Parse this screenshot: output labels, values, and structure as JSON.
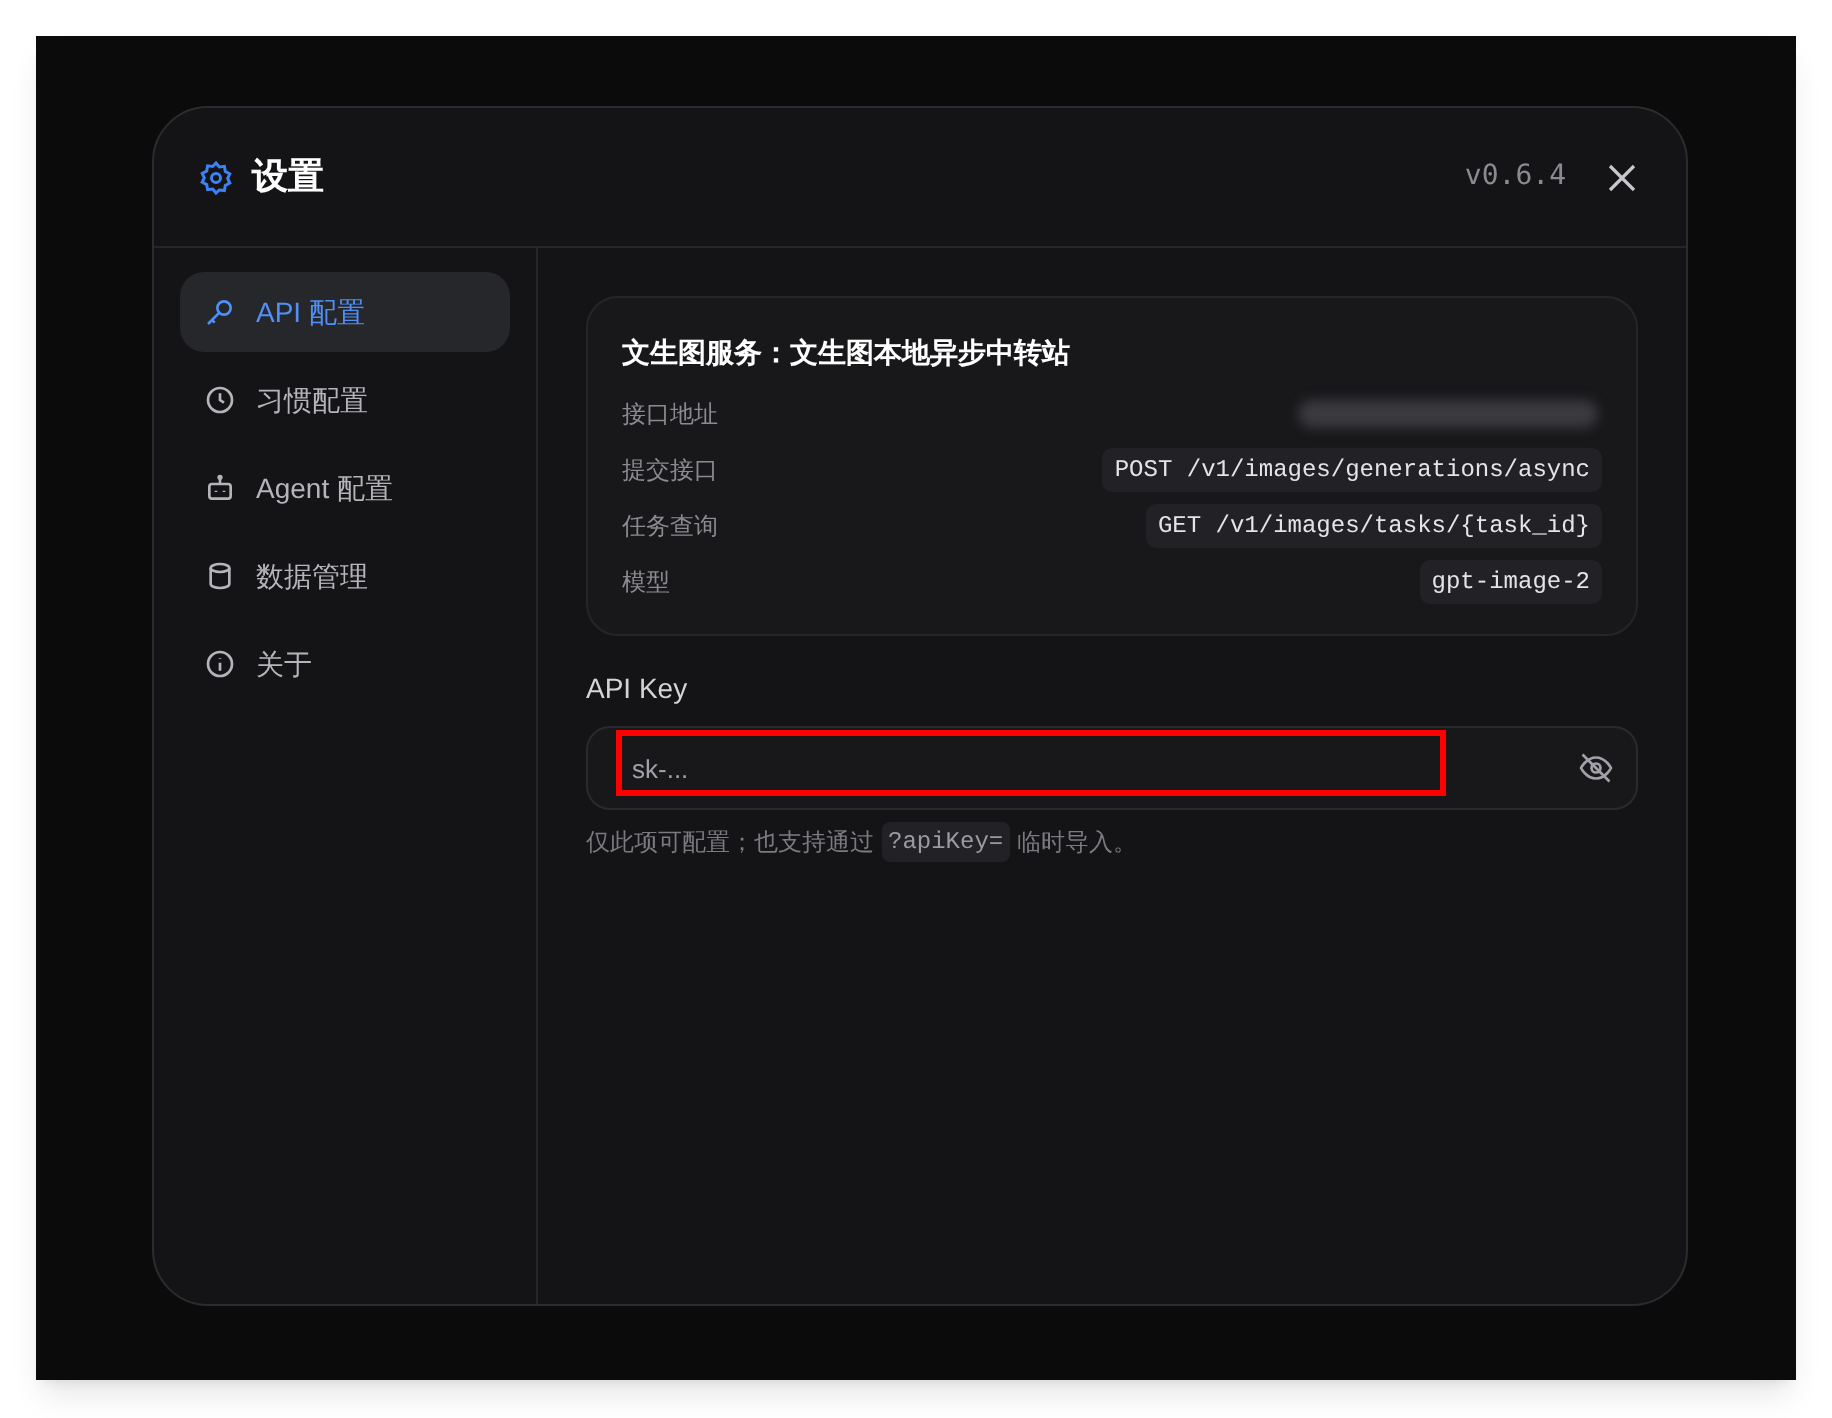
{
  "dialog": {
    "title": "设置",
    "version": "v0.6.4"
  },
  "sidebar": {
    "items": [
      {
        "label": "API 配置",
        "kind": "key",
        "selected": true
      },
      {
        "label": "习惯配置",
        "kind": "clock",
        "selected": false
      },
      {
        "label": "Agent 配置",
        "kind": "bot",
        "selected": false
      },
      {
        "label": "数据管理",
        "kind": "database",
        "selected": false
      },
      {
        "label": "关于",
        "kind": "info",
        "selected": false
      }
    ]
  },
  "service_card": {
    "title": "文生图服务：文生图本地异步中转站",
    "rows": [
      {
        "label": "接口地址",
        "kind": "redacted"
      },
      {
        "label": "提交接口",
        "kind": "code",
        "value": "POST /v1/images/generations/async"
      },
      {
        "label": "任务查询",
        "kind": "code",
        "value": "GET /v1/images/tasks/{task_id}"
      },
      {
        "label": "模型",
        "kind": "code",
        "value": "gpt-image-2"
      }
    ]
  },
  "api_key": {
    "label": "API Key",
    "placeholder": "sk-...",
    "highlighted": true,
    "hint_before": "仅此项可配置；也支持通过",
    "hint_code": "?apiKey=",
    "hint_after": "临时导入。"
  }
}
